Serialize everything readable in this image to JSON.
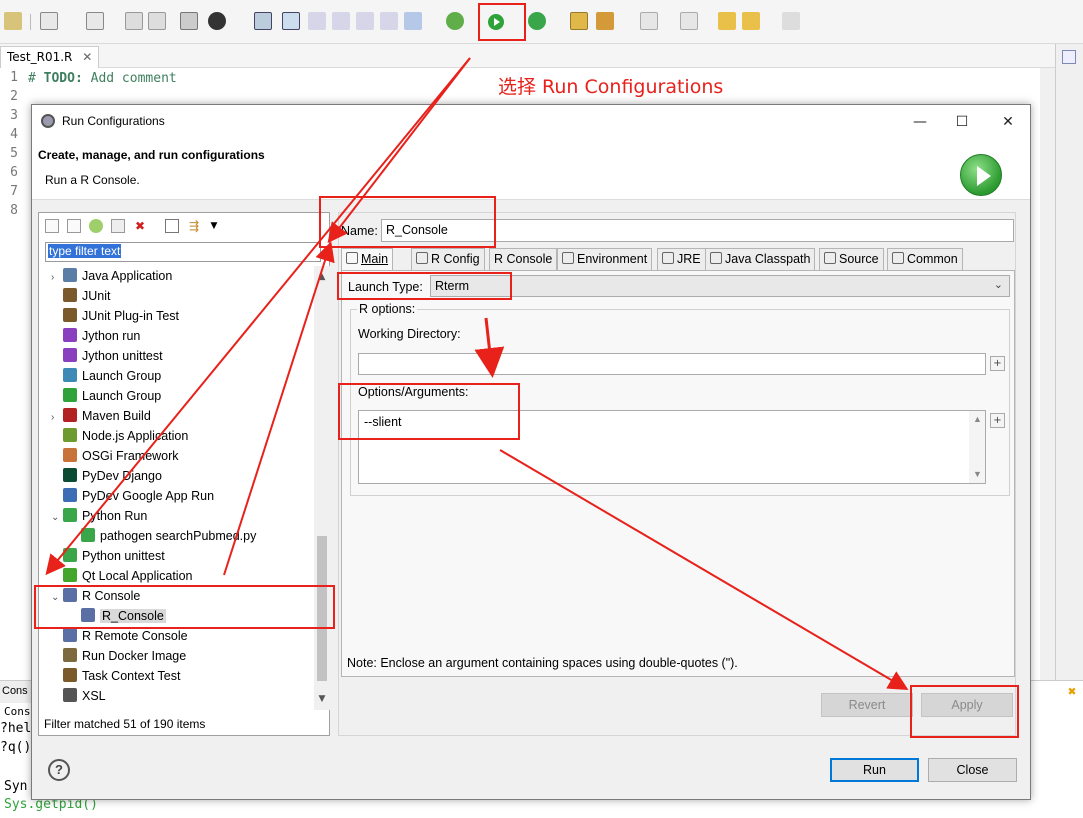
{
  "ide": {
    "editor_tab": "Test_R01.R",
    "line_numbers": [
      "1",
      "2",
      "3",
      "4",
      "5",
      "6",
      "7",
      "8"
    ],
    "code_line1_prefix": "# ",
    "code_line1_todo": "TODO:",
    "code_line1_rest": " Add comment",
    "console_tab": "Cons",
    "console_lines": [
      "Conso",
      "?hel",
      "?q()",
      "",
      "Syn",
      "Sys.getpid()"
    ]
  },
  "annotation": "选择 Run Configurations",
  "dialog": {
    "title": "Run Configurations",
    "header_title": "Create, manage, and run configurations",
    "header_subtitle": "Run a R Console.",
    "filter_value": "type filter text",
    "filter_status": "Filter matched 51 of 190 items",
    "tree": [
      {
        "label": "Java Application",
        "indent": 0,
        "expander": "›",
        "icon": "java-app-icon",
        "color": "#5a7ea6"
      },
      {
        "label": "JUnit",
        "indent": 0,
        "expander": "",
        "icon": "junit-icon",
        "color": "#7a5a2a"
      },
      {
        "label": "JUnit Plug-in Test",
        "indent": 0,
        "expander": "",
        "icon": "junit-plugin-icon",
        "color": "#7a5a2a"
      },
      {
        "label": "Jython run",
        "indent": 0,
        "expander": "",
        "icon": "jython-icon",
        "color": "#8a3fbf"
      },
      {
        "label": "Jython unittest",
        "indent": 0,
        "expander": "",
        "icon": "jython-unittest-icon",
        "color": "#8a3fbf"
      },
      {
        "label": "Launch Group",
        "indent": 0,
        "expander": "",
        "icon": "launch-group-icon",
        "color": "#3c8ab5"
      },
      {
        "label": "Launch Group",
        "indent": 0,
        "expander": "",
        "icon": "launch-group-run-icon",
        "color": "#2fa33a"
      },
      {
        "label": "Maven Build",
        "indent": 0,
        "expander": "›",
        "icon": "maven-icon",
        "color": "#b22222"
      },
      {
        "label": "Node.js Application",
        "indent": 0,
        "expander": "",
        "icon": "nodejs-icon",
        "color": "#6d9b2f"
      },
      {
        "label": "OSGi Framework",
        "indent": 0,
        "expander": "",
        "icon": "osgi-icon",
        "color": "#c8733a"
      },
      {
        "label": "PyDev Django",
        "indent": 0,
        "expander": "",
        "icon": "django-icon",
        "color": "#0c4b33"
      },
      {
        "label": "PyDev Google App Run",
        "indent": 0,
        "expander": "",
        "icon": "google-app-icon",
        "color": "#3d6db5"
      },
      {
        "label": "Python Run",
        "indent": 0,
        "expander": "⌄",
        "icon": "python-run-icon",
        "color": "#3aa64a"
      },
      {
        "label": "pathogen searchPubmed.py",
        "indent": 1,
        "expander": "",
        "icon": "python-file-icon",
        "color": "#3aa64a"
      },
      {
        "label": "Python unittest",
        "indent": 0,
        "expander": "",
        "icon": "python-unittest-icon",
        "color": "#3aa64a"
      },
      {
        "label": "Qt Local Application",
        "indent": 0,
        "expander": "",
        "icon": "qt-icon",
        "color": "#41a62a"
      },
      {
        "label": "R Console",
        "indent": 0,
        "expander": "⌄",
        "icon": "r-console-icon",
        "color": "#5a6fa3"
      },
      {
        "label": "R_Console",
        "indent": 1,
        "expander": "",
        "icon": "r-console-config-icon",
        "color": "#5a6fa3",
        "selected": true
      },
      {
        "label": "R Remote Console",
        "indent": 0,
        "expander": "",
        "icon": "r-remote-icon",
        "color": "#5a6fa3"
      },
      {
        "label": "Run Docker Image",
        "indent": 0,
        "expander": "",
        "icon": "docker-icon",
        "color": "#7c6a3e"
      },
      {
        "label": "Task Context Test",
        "indent": 0,
        "expander": "",
        "icon": "task-context-icon",
        "color": "#7a5a2a"
      },
      {
        "label": "XSL",
        "indent": 0,
        "expander": "",
        "icon": "xsl-icon",
        "color": "#555555"
      }
    ],
    "name_label": "Name:",
    "name_value": "R_Console",
    "tabs": [
      "Main",
      "R Config",
      "R Console",
      "Environment",
      "JRE",
      "Java Classpath",
      "Source",
      "Common"
    ],
    "launch_type_label": "Launch Type:",
    "launch_type_value": "Rterm",
    "r_options_label": "R options:",
    "working_dir_label": "Working Directory:",
    "working_dir_value": "",
    "options_label": "Options/Arguments:",
    "options_value": "--slient",
    "plus_label": "+",
    "note": "Note: Enclose an argument containing spaces using double-quotes (\").",
    "revert_label": "Revert",
    "apply_label": "Apply",
    "run_label": "Run",
    "close_label": "Close",
    "help_glyph": "?"
  },
  "colors": {
    "annotation_red": "#e8211b",
    "run_green": "#2fa33a",
    "selection_blue": "#3373d9"
  }
}
